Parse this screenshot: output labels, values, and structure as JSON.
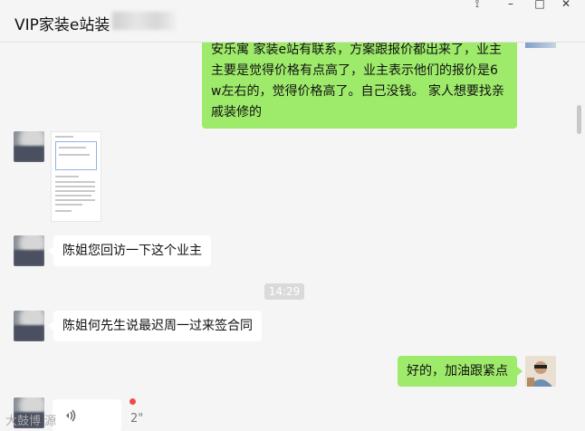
{
  "window": {
    "title": "VIP家装e站装",
    "controls": [
      "pin-icon",
      "minimize-icon",
      "maximize-icon",
      "close-icon"
    ]
  },
  "messages": {
    "m1_lines": [
      "安乐寓 家装e站有联系，方案跟报价都出来了，业主",
      "主要是觉得价格有点高了，业主表示他们的报价是6",
      "w左右的，觉得价格高了。自己没钱。  家人想要找亲",
      "戚装修的"
    ],
    "m3": "陈姐您回访一下这个业主",
    "time": "14:29",
    "m4": "陈姐何先生说最迟周一过来签合同",
    "m5": "好的，加油跟紧点",
    "voice_len": "2\""
  },
  "watermark": "大鼓博 源",
  "colors": {
    "green_bubble": "#9eea6a",
    "background": "#f5f5f5"
  }
}
